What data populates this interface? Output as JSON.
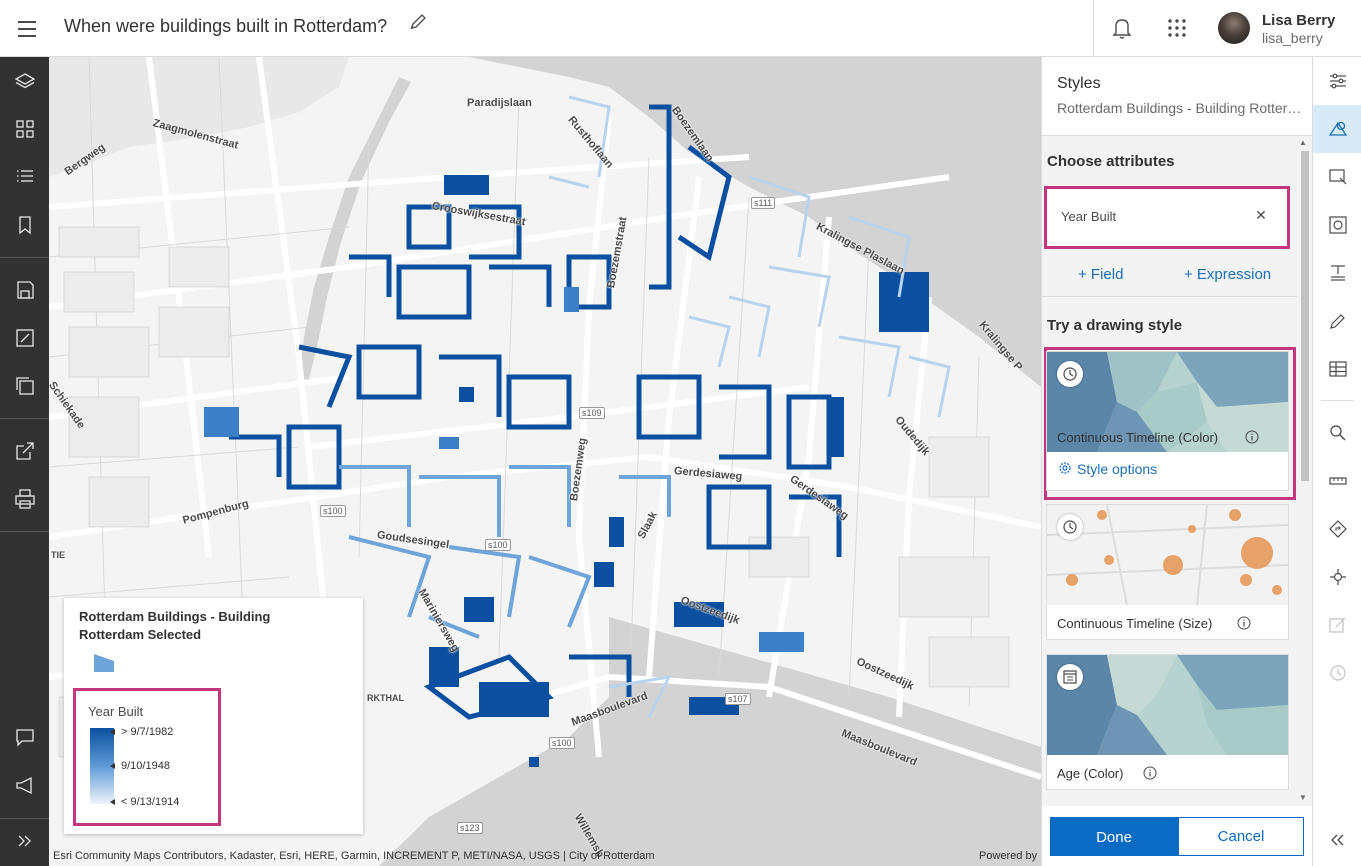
{
  "header": {
    "title": "When were buildings built in Rotterdam?",
    "user_name": "Lisa Berry",
    "user_id": "lisa_berry"
  },
  "left_toolbar": [
    "layers-icon",
    "basemap-icon",
    "legend-icon",
    "bookmark-icon",
    "save-icon",
    "edit-map-icon",
    "save-as-icon",
    "share-icon",
    "print-icon",
    "feedback-icon",
    "announcement-icon",
    "expand-icon"
  ],
  "map": {
    "streets": [
      "Paradijslaan",
      "Boezemlaan",
      "Rusthoflaan",
      "Zaagmolenstraat",
      "Bergweg",
      "Crooswijksestraat",
      "Boezemstraat",
      "Kralingse Plaslaan",
      "Kralingse P",
      "Schiekade",
      "Oudedijk",
      "Boezemweg",
      "Gerdesiaweg",
      "Gerdesiaweg",
      "Pompenburg",
      "Goudsesingel",
      "Slaak",
      "Oostzeedijk",
      "Mariniersweg",
      "Oostzeedijk",
      "Maasboulevard",
      "Maasboulevard",
      "Willemsb",
      "TIE",
      "RKTHAL"
    ],
    "shields": [
      "s111",
      "s109",
      "s100",
      "s100",
      "s107",
      "s100",
      "s123"
    ],
    "attribution": "Esri Community Maps Contributors, Kadaster, Esri, HERE, Garmin, INCREMENT P, METI/NASA, USGS | City of Rotterdam",
    "powered": "Powered by"
  },
  "legend": {
    "title": "Rotterdam Buildings - Building Rotterdam Selected",
    "field": "Year Built",
    "max_label": "> 9/7/1982",
    "mid_label": "9/10/1948",
    "min_label": "< 9/13/1914",
    "ramp_colors": [
      "#0a4fa0",
      "#5e9ad6",
      "#eef4fb"
    ]
  },
  "panel": {
    "heading": "Styles",
    "subtitle": "Rotterdam Buildings - Building Rotterdam Selected",
    "choose_heading": "Choose attributes",
    "attribute": "Year Built",
    "add_field": "+ Field",
    "add_expression": "+ Expression",
    "try_heading": "Try a drawing style",
    "cards": [
      {
        "label": "Continuous Timeline (Color)",
        "options": "Style options",
        "selected": true
      },
      {
        "label": "Continuous Timeline (Size)"
      },
      {
        "label": "Age (Color)"
      }
    ],
    "done": "Done",
    "cancel": "Cancel"
  },
  "right_toolbar": [
    "properties-icon",
    "styles-icon",
    "configure-popups-icon",
    "configure-clustering-icon",
    "labels-icon",
    "sketch-icon",
    "table-icon",
    "search-icon",
    "measure-icon",
    "directions-icon",
    "location-icon",
    "edit-icon",
    "time-icon",
    "collapse-icon"
  ],
  "colors": {
    "accent": "#0a6bc4",
    "highlight": "#c4367e",
    "dark_bar": "#323232"
  }
}
